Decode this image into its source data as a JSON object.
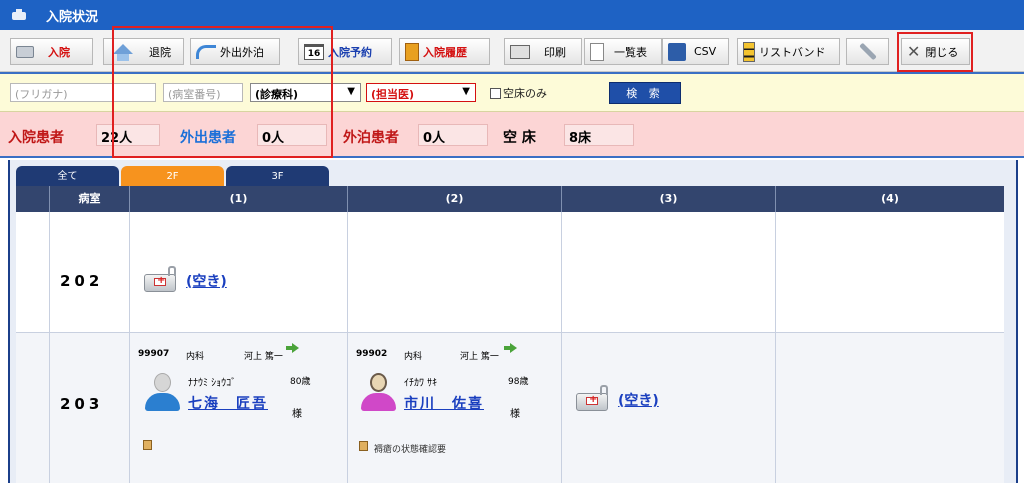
{
  "window": {
    "title": "入院状況"
  },
  "toolbar": {
    "admit": "入院",
    "discharge": "退院",
    "outing": "外出外泊",
    "reservation_num": "16",
    "reservation": "入院予約",
    "history": "入院履歴",
    "print": "印刷",
    "list": "一覧表",
    "csv": "CSV",
    "wristband": "リストバンド",
    "close": "閉じる"
  },
  "search": {
    "furigana_placeholder": "(フリガナ)",
    "room_placeholder": "(病室番号)",
    "department": "(診療科)",
    "doctor": "(担当医)",
    "vacant_only": "空床のみ",
    "button": "検 索"
  },
  "summary": {
    "inpatients_label": "入院患者",
    "inpatients_value": "22人",
    "outing_label": "外出患者",
    "outing_value": "0人",
    "overnight_label": "外泊患者",
    "overnight_value": "0人",
    "vacant_label": "空 床",
    "vacant_value": "8床"
  },
  "tabs": [
    "全て",
    "2F",
    "3F"
  ],
  "table": {
    "headers": [
      "病室",
      "(1)",
      "(2)",
      "(3)",
      "(4)"
    ],
    "rows": [
      {
        "room": "202",
        "vacant_label": "(空き)"
      },
      {
        "room": "203",
        "patients": [
          {
            "id": "99907",
            "dept": "内科",
            "doctor": "河上 篤一",
            "kana": "ﾅﾅｳﾐ ｼｮｳｺﾞ",
            "age": "80歳",
            "name": "七海　匠吾",
            "sama": "様",
            "note": ""
          },
          {
            "id": "99902",
            "dept": "内科",
            "doctor": "河上 篤一",
            "kana": "ｲﾁｶﾜ ｻｷ",
            "age": "98歳",
            "name": "市川　佐喜",
            "sama": "様",
            "note": "褥瘡の状態確認要"
          }
        ],
        "vacant_label": "(空き)"
      }
    ]
  },
  "colors": {
    "titlebar": "#1e62c4",
    "accent_red": "#e02020",
    "tab_active": "#f7931e",
    "header": "#33456e"
  }
}
